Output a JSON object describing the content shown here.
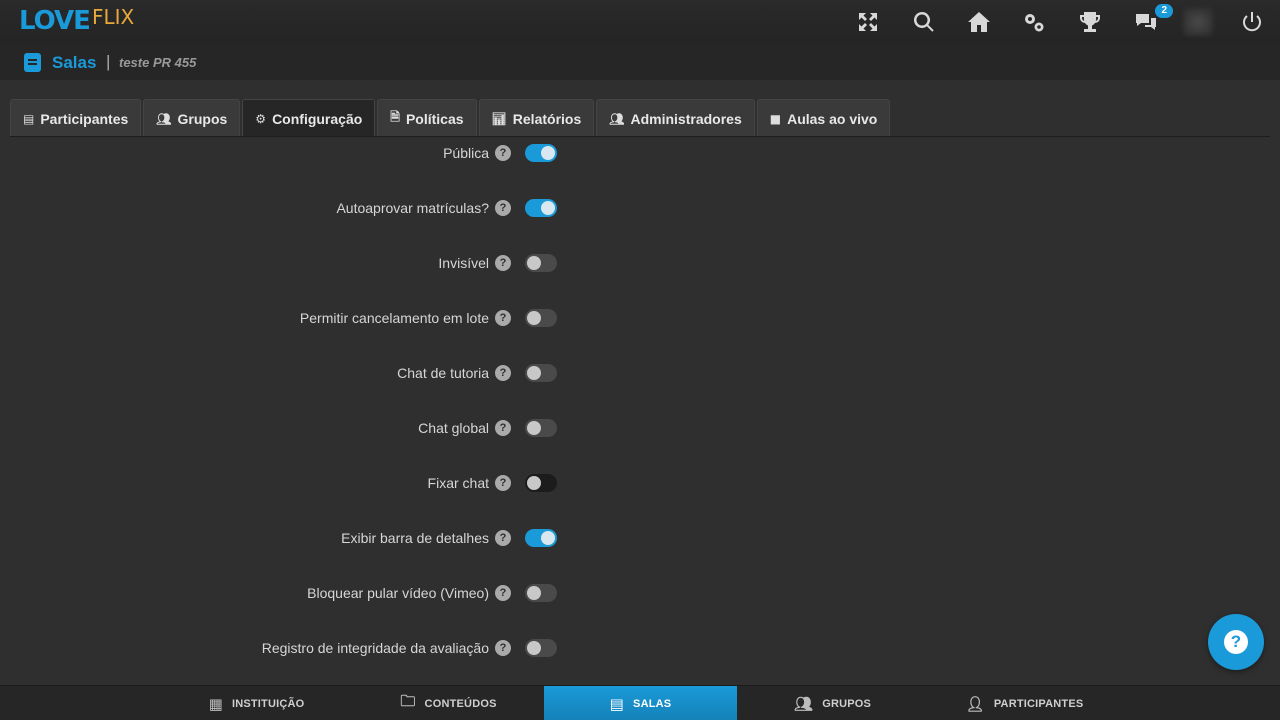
{
  "brand": {
    "love": "LOVE",
    "flix": "FLIX"
  },
  "header": {
    "icons": [
      "fullscreen-icon",
      "search-icon",
      "home-icon",
      "settings-icon",
      "trophy-icon",
      "chat-icon",
      "avatar",
      "power-icon"
    ],
    "chat_badge": "2"
  },
  "subheader": {
    "title": "Salas",
    "separator": "|",
    "course": "teste PR 455"
  },
  "tabs": [
    {
      "label": "Participantes",
      "icon": "book-icon"
    },
    {
      "label": "Grupos",
      "icon": "users-icon"
    },
    {
      "label": "Configuração",
      "icon": "cogs-icon",
      "active": true
    },
    {
      "label": "Políticas",
      "icon": "file-icon"
    },
    {
      "label": "Relatórios",
      "icon": "chart-icon"
    },
    {
      "label": "Administradores",
      "icon": "users-icon"
    },
    {
      "label": "Aulas ao vivo",
      "icon": "video-icon"
    }
  ],
  "settings": [
    {
      "label": "Pública",
      "on": true
    },
    {
      "label": "Autoaprovar matrículas?",
      "on": true
    },
    {
      "label": "Invisível",
      "on": false
    },
    {
      "label": "Permitir cancelamento em lote",
      "on": false
    },
    {
      "label": "Chat de tutoria",
      "on": false
    },
    {
      "label": "Chat global",
      "on": false
    },
    {
      "label": "Fixar chat",
      "on": false
    },
    {
      "label": "Exibir barra de detalhes",
      "on": true
    },
    {
      "label": "Bloquear pular vídeo (Vimeo)",
      "on": false
    },
    {
      "label": "Registro de integridade da avaliação",
      "on": false
    }
  ],
  "help_glyph": "?",
  "bottom_nav": [
    {
      "label": "INSTITUIÇÃO",
      "icon": "building-icon"
    },
    {
      "label": "CONTEÚDOS",
      "icon": "folder-icon"
    },
    {
      "label": "SALAS",
      "icon": "book-icon",
      "active": true
    },
    {
      "label": "GRUPOS",
      "icon": "users-icon"
    },
    {
      "label": "PARTICIPANTES",
      "icon": "user-icon"
    }
  ],
  "colors": {
    "accent": "#1a9ad9",
    "logo_flix": "#e8a93a",
    "background": "#2f2f2f"
  }
}
